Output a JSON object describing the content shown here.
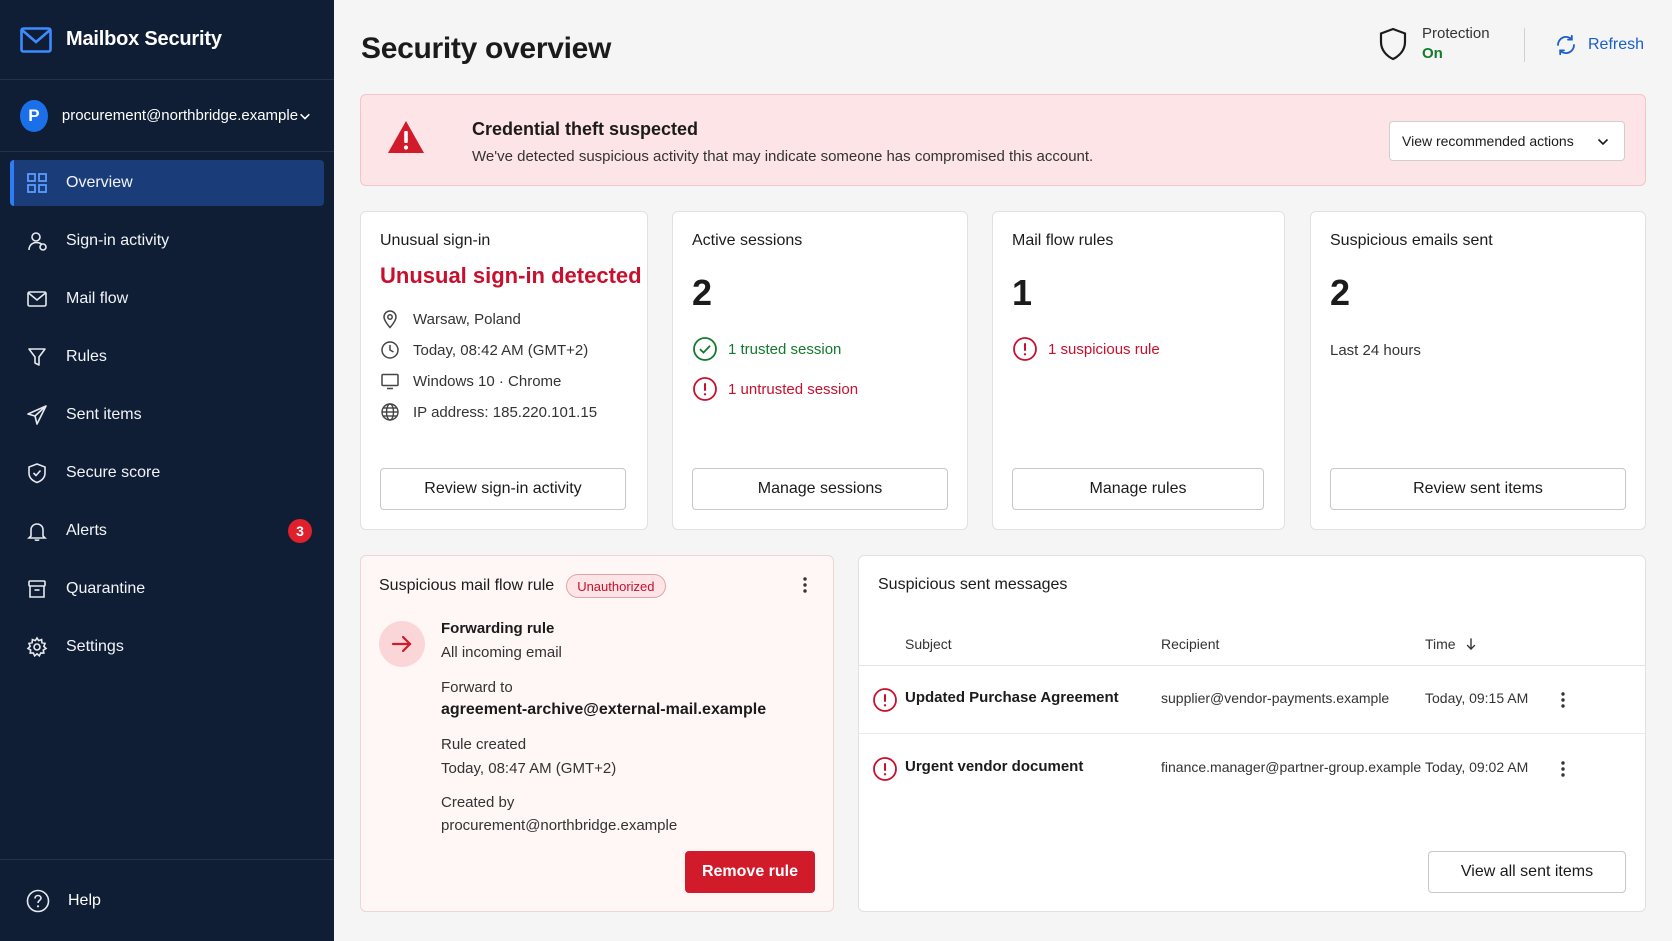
{
  "app": {
    "title": "Mailbox Security"
  },
  "account": {
    "initial": "P",
    "email": "procurement@northbridge.example"
  },
  "nav": {
    "items": [
      {
        "label": "Overview",
        "icon": "grid-icon",
        "active": true
      },
      {
        "label": "Sign-in activity",
        "icon": "user-icon"
      },
      {
        "label": "Mail flow",
        "icon": "mail-icon"
      },
      {
        "label": "Rules",
        "icon": "filter-icon"
      },
      {
        "label": "Sent items",
        "icon": "send-icon"
      },
      {
        "label": "Secure score",
        "icon": "shield-check-icon"
      },
      {
        "label": "Alerts",
        "icon": "bell-icon",
        "badge": "3"
      },
      {
        "label": "Quarantine",
        "icon": "archive-icon"
      },
      {
        "label": "Settings",
        "icon": "gear-icon"
      }
    ],
    "help": "Help"
  },
  "header": {
    "title": "Security overview",
    "protection_label": "Protection",
    "protection_state": "On",
    "refresh": "Refresh"
  },
  "alert": {
    "title": "Credential theft suspected",
    "text": "We've detected suspicious activity that may indicate someone has compromised this account.",
    "action": "View recommended actions"
  },
  "cards": {
    "signin": {
      "title": "Unusual sign-in",
      "headline": "Unusual sign-in detected",
      "location": "Warsaw, Poland",
      "time": "Today, 08:42 AM (GMT+2)",
      "device": "Windows 10 · Chrome",
      "ip": "IP address: 185.220.101.15",
      "button": "Review sign-in activity"
    },
    "sessions": {
      "title": "Active sessions",
      "count": "2",
      "trusted": "1 trusted session",
      "untrusted": "1 untrusted session",
      "button": "Manage sessions"
    },
    "rules": {
      "title": "Mail flow rules",
      "count": "1",
      "suspicious": "1 suspicious rule",
      "button": "Manage rules"
    },
    "sent": {
      "title": "Suspicious emails sent",
      "count": "2",
      "period": "Last 24 hours",
      "button": "Review sent items"
    }
  },
  "rule_panel": {
    "title": "Suspicious mail flow rule",
    "badge": "Unauthorized",
    "rule_name": "Forwarding rule",
    "scope": "All incoming email",
    "forward_label": "Forward to",
    "forward_to": "agreement-archive@external-mail.example",
    "created_label": "Rule created",
    "created_at": "Today, 08:47 AM (GMT+2)",
    "created_by_label": "Created by",
    "created_by": "procurement@northbridge.example",
    "button": "Remove rule"
  },
  "messages": {
    "title": "Suspicious sent messages",
    "columns": {
      "subject": "Subject",
      "recipient": "Recipient",
      "time": "Time"
    },
    "rows": [
      {
        "subject": "Updated Purchase Agreement",
        "recipient": "supplier@vendor-payments.example",
        "time": "Today, 09:15 AM"
      },
      {
        "subject": "Urgent vendor document",
        "recipient": "finance.manager@partner-group.example",
        "time": "Today, 09:02 AM"
      }
    ],
    "button": "View all sent items"
  },
  "colors": {
    "sidebar_bg": "#0f1e35",
    "accent": "#1a5fc9",
    "danger": "#d11a2a",
    "success": "#137a2e"
  }
}
